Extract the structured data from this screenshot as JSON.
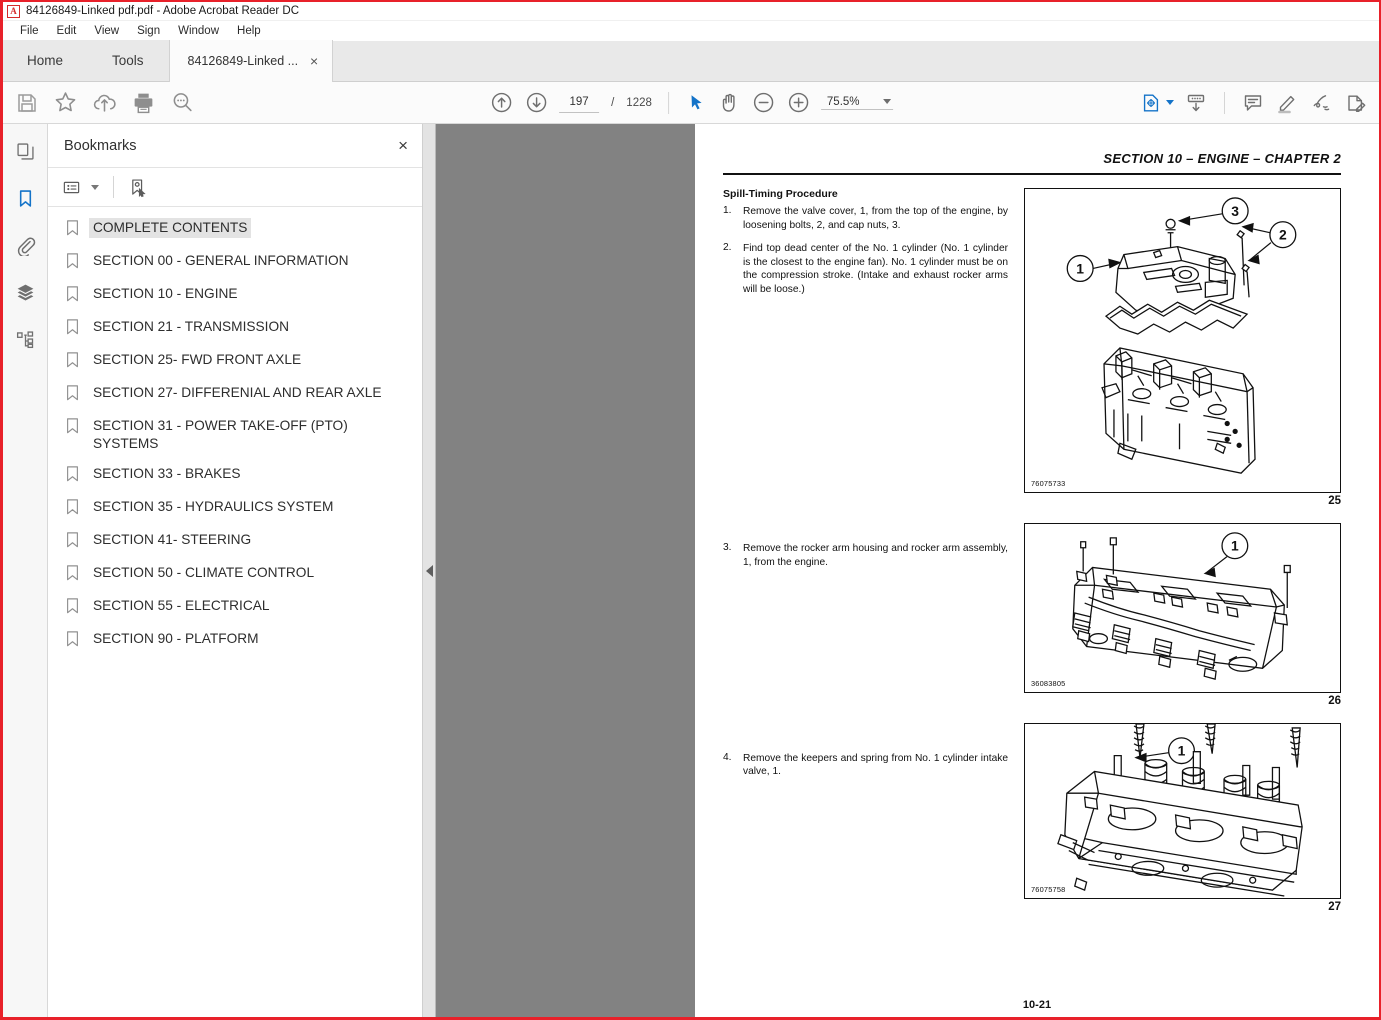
{
  "window": {
    "title": "84126849-Linked pdf.pdf - Adobe Acrobat Reader DC",
    "logo_glyph": "A"
  },
  "menubar": {
    "items": [
      "File",
      "Edit",
      "View",
      "Sign",
      "Window",
      "Help"
    ]
  },
  "tabs": {
    "home": "Home",
    "tools": "Tools",
    "document": "84126849-Linked ...",
    "close_glyph": "×"
  },
  "toolbar": {
    "left_icons": [
      "save-icon",
      "star-icon",
      "upload-cloud-icon",
      "print-icon",
      "search-icon"
    ],
    "page_current": "197",
    "page_separator": "/",
    "page_total": "1228",
    "nav_prev": "previous-page-icon",
    "nav_next": "next-page-icon",
    "select_tool": "select-cursor-icon",
    "hand_tool": "hand-icon",
    "zoom_out": "zoom-out-icon",
    "zoom_in": "zoom-in-icon",
    "zoom_level": "75.5%",
    "fit_page": "fit-page-icon",
    "scroll_mode": "scroll-mode-icon",
    "comment": "comment-icon",
    "highlight": "highlight-pen-icon",
    "sign": "sign-icon",
    "fill_and_sign": "fill-and-sign-icon",
    "accent_color": "#1473c8"
  },
  "rail": {
    "items": [
      {
        "name": "page-thumbnails-icon",
        "active": false
      },
      {
        "name": "bookmarks-icon",
        "active": true
      },
      {
        "name": "attachments-icon",
        "active": false
      },
      {
        "name": "layers-icon",
        "active": false
      },
      {
        "name": "tags-icon",
        "active": false
      }
    ]
  },
  "panel": {
    "title": "Bookmarks",
    "close_glyph": "×",
    "options_icon": "bookmark-options-icon",
    "new_bookmark_icon": "new-bookmark-icon",
    "bookmarks": [
      {
        "label": "COMPLETE CONTENTS",
        "selected": true
      },
      {
        "label": "SECTION 00 - GENERAL INFORMATION",
        "selected": false
      },
      {
        "label": "SECTION 10 - ENGINE",
        "selected": false
      },
      {
        "label": "SECTION 21 - TRANSMISSION",
        "selected": false
      },
      {
        "label": "SECTION 25- FWD FRONT AXLE",
        "selected": false
      },
      {
        "label": "SECTION 27- DIFFERENIAL AND REAR AXLE",
        "selected": false
      },
      {
        "label": "SECTION 31 - POWER TAKE-OFF (PTO) SYSTEMS",
        "selected": false
      },
      {
        "label": "SECTION 33 - BRAKES",
        "selected": false
      },
      {
        "label": "SECTION 35 - HYDRAULICS SYSTEM",
        "selected": false
      },
      {
        "label": "SECTION 41- STEERING",
        "selected": false
      },
      {
        "label": "SECTION 50 - CLIMATE CONTROL",
        "selected": false
      },
      {
        "label": "SECTION 55 - ELECTRICAL",
        "selected": false
      },
      {
        "label": "SECTION 90 - PLATFORM",
        "selected": false
      }
    ]
  },
  "document": {
    "header": "SECTION 10 – ENGINE – CHAPTER 2",
    "procedure_title": "Spill-Timing Procedure",
    "steps": [
      {
        "num": "1.",
        "text": "Remove the valve cover, 1, from the top of the engine, by loosening bolts, 2, and cap nuts, 3."
      },
      {
        "num": "2.",
        "text": "Find top dead center of the No. 1 cylinder (No. 1 cylinder is the closest to the engine fan). No. 1 cylinder must be on the compression stroke. (Intake and exhaust rocker arms will be loose.)"
      },
      {
        "num": "3.",
        "text": "Remove the rocker arm housing and rocker arm assembly, 1, from the engine."
      },
      {
        "num": "4.",
        "text": "Remove the keepers and spring from No. 1 cylinder intake valve, 1."
      }
    ],
    "figures": [
      {
        "id": "76075733",
        "number": "25",
        "callouts": [
          "1",
          "2",
          "3"
        ],
        "caption": "engine valve cover exploded view"
      },
      {
        "id": "36083805",
        "number": "26",
        "callouts": [
          "1"
        ],
        "caption": "rocker arm housing assembly"
      },
      {
        "id": "76075758",
        "number": "27",
        "callouts": [
          "1"
        ],
        "caption": "cylinder head valve springs and keepers"
      }
    ],
    "page_footer": "10-21"
  }
}
